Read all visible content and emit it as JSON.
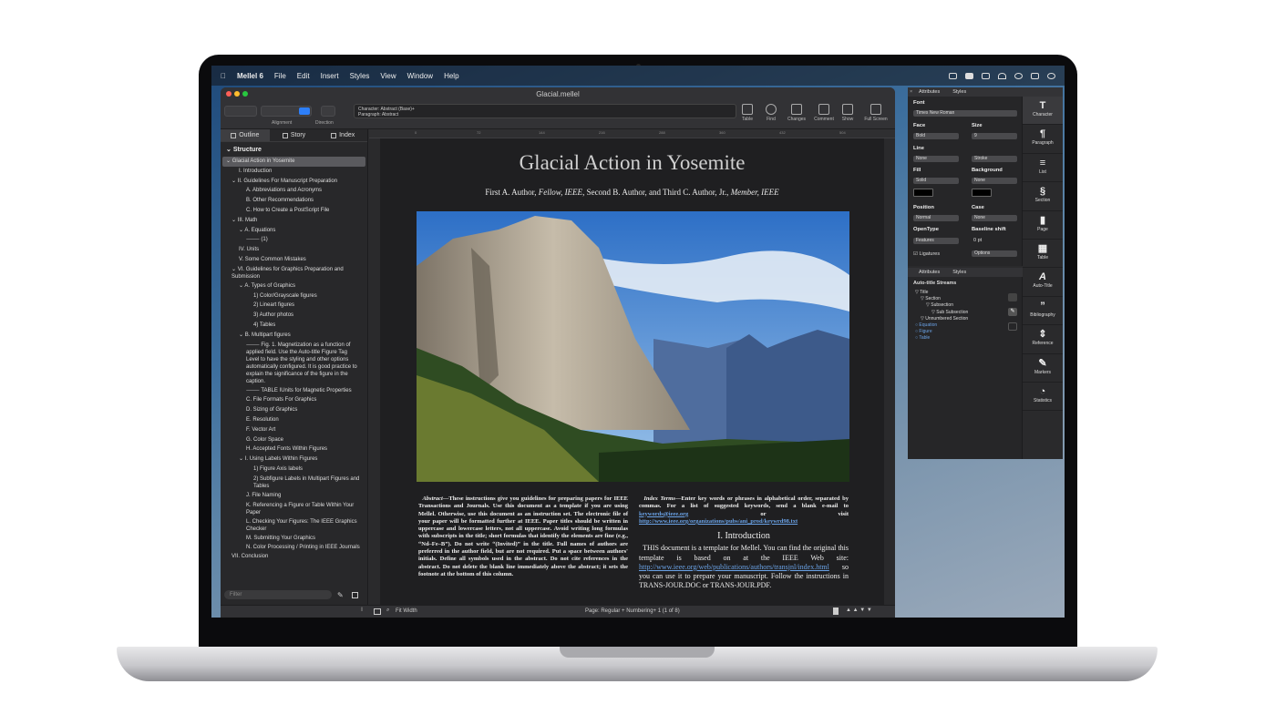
{
  "menubar": {
    "app_name": "Mellel 6",
    "items": [
      "File",
      "Edit",
      "Insert",
      "Styles",
      "View",
      "Window",
      "Help"
    ]
  },
  "window": {
    "title": "Glacial.mellel"
  },
  "toolbar": {
    "alignment_label": "Alignment",
    "direction_label": "Direction",
    "char_info_line1": "Character: Abstract (Base)+",
    "char_info_line2": "Paragraph: Abstract",
    "buttons": {
      "table": "Table",
      "find": "Find",
      "changes": "Changes",
      "comment": "Comment",
      "show": "Show",
      "fullscreen": "Full Screen"
    }
  },
  "sidebar": {
    "tabs": {
      "outline": "Outline",
      "story": "Story",
      "index": "Index"
    },
    "structure_heading": "Structure",
    "items": [
      "Glacial Action in Yosemite",
      "I. Introduction",
      "II. Guidelines For Manuscript Preparation",
      "A. Abbreviations and Acronyms",
      "B. Other Recommendations",
      "C. How to Create a PostScript File",
      "III. Math",
      "A. Equations",
      "(1)",
      "IV. Units",
      "V. Some Common Mistakes",
      "VI. Guidelines for Graphics Preparation and Submission",
      "A. Types of Graphics",
      "1) Color/Grayscale figures",
      "2) Lineart figures",
      "3) Author photos",
      "4) Tables",
      "B. Multipart figures",
      "Fig. 1.  Magnetization as a function of applied field. Use the Auto-title Figure Tag Level to have the styling and other options automatically configured. It is good practice to explain the significance of the figure in the caption.",
      "TABLE IUnits for Magnetic Properties",
      "C. File Formats For Graphics",
      "D. Sizing of Graphics",
      "E. Resolution",
      "F. Vector Art",
      "G. Color Space",
      "H. Accepted Fonts Within Figures",
      "I. Using Labels Within Figures",
      "1) Figure Axis labels",
      "2) Subfigure Labels in Multipart Figures and Tables",
      "J. File Naming",
      "K. Referencing a Figure or Table Within Your Paper",
      "L. Checking Your Figures: The IEEE Graphics Checker",
      "M. Submitting Your Graphics",
      "N. Color Processing / Printing in IEEE Journals",
      "VII. Conclusion"
    ],
    "filter_placeholder": "Filter"
  },
  "ruler": {
    "ticks": [
      "0",
      "72",
      "144",
      "216",
      "288",
      "360",
      "432",
      "504"
    ]
  },
  "document": {
    "title": "Glacial Action in Yosemite",
    "authors_a": "First A. Author, ",
    "authors_a_it": "Fellow, IEEE",
    "authors_b": ", Second B. Author, and Third C. Author, Jr., ",
    "authors_b_it": "Member, IEEE",
    "abstract_label": "Abstract",
    "abstract_text": "—These instructions give you guidelines for preparing papers for IEEE Transactions and Journals. Use this document as a template if you are using Mellel. Otherwise, use this document as an instruction set. The electronic file of your paper will be formatted further at IEEE. Paper titles should be written in uppercase and lowercase letters, not all uppercase. Avoid writing long formulas with subscripts in the title; short formulas that identify the elements are fine (e.g., “Nd–Fe–B”). Do not write “(Invited)” in the title. Full names of authors are preferred in the author field, but are not required. Put a space between authors' initials. Define all symbols used in the abstract. Do not cite references in the abstract. Do not delete the blank line immediately above the abstract; it sets the footnote at the bottom of this column.",
    "index_terms_label": "Index Terms",
    "index_terms_text": "—Enter key words or phrases in alphabetical order, separated by commas. For a list of suggested keywords, send a blank e-mail to ",
    "index_email": "keywords@ieee.org",
    "index_or_visit": " or visit ",
    "index_url": "http://www.ieee.org/organizations/pubs/ani_prod/keywrd98.txt",
    "intro_heading": "I. Introduction",
    "intro_text": "THIS document is a template for Mellel. You can find the original this template is based on at the IEEE Web site: ",
    "intro_url": "http://www.ieee.org/web/publications/authors/transjnl/index.html",
    "intro_text2": " so you can use it to prepare your manuscript. Follow the instructions in TRANS-JOUR.DOC or TRANS-JOUR.PDF."
  },
  "statusbar": {
    "zoom": "Fit Width",
    "page_info": "Page: Regular + Numbering+ 1 (1 of 8)"
  },
  "inspector": {
    "tab_attributes": "Attributes",
    "tab_styles": "Styles",
    "font_label": "Font",
    "font_value": "Times New Roman",
    "face_label": "Face",
    "face_value": "Bold",
    "size_label": "Size",
    "size_value": "9",
    "line_label": "Line",
    "line_value": "None",
    "line_style_value": "Stroke",
    "fill_label": "Fill",
    "fill_value": "Solid",
    "background_label": "Background",
    "background_value": "None",
    "position_label": "Position",
    "position_value": "Normal",
    "case_label": "Case",
    "case_value": "None",
    "opentype_label": "OpenType",
    "opentype_value": "Features",
    "baseline_label": "Baseline shift",
    "baseline_value": "0 pt",
    "ligatures_label": "Ligatures",
    "options_value": "Options",
    "autotitle_heading": "Auto-title Streams",
    "autotitle_items": [
      "Title",
      "Section",
      "Subsection",
      "Sub Subsection",
      "Unnumbered Section",
      "Equation",
      "Figure",
      "Table"
    ]
  },
  "rail": {
    "items": [
      "Character",
      "Paragraph",
      "List",
      "Section",
      "Page",
      "Table",
      "Auto-Title",
      "Bibliography",
      "Reference",
      "Markers",
      "Statistics"
    ]
  }
}
